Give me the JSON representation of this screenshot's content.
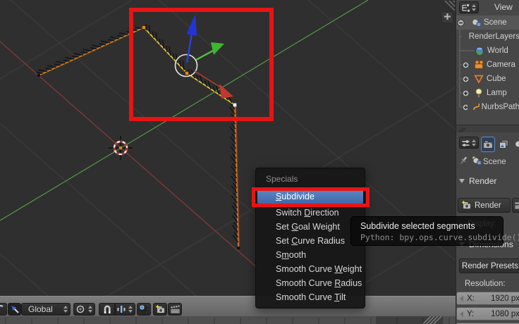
{
  "viewport": {
    "header": {
      "orientation_value": "Global"
    },
    "menu": {
      "title": "Specials",
      "items": [
        {
          "pre": "",
          "key": "S",
          "post": "ubdivide"
        },
        {
          "pre": "Switch ",
          "key": "D",
          "post": "irection"
        },
        {
          "pre": "Set ",
          "key": "G",
          "post": "oal Weight"
        },
        {
          "pre": "Set ",
          "key": "C",
          "post": "urve Radius"
        },
        {
          "pre": "S",
          "key": "m",
          "post": "ooth"
        },
        {
          "pre": "Smooth Curve ",
          "key": "W",
          "post": "eight"
        },
        {
          "pre": "Smooth Curve ",
          "key": "R",
          "post": "adius"
        },
        {
          "pre": "Smooth Curve ",
          "key": "T",
          "post": "ilt"
        }
      ]
    },
    "tooltip": {
      "title": "Subdivide selected segments",
      "python": "Python: bpy.ops.curve.subdivide()"
    }
  },
  "outliner": {
    "menu_label": "View",
    "items": [
      {
        "label": "Scene"
      },
      {
        "label": "RenderLayers"
      },
      {
        "label": "World"
      },
      {
        "label": "Camera"
      },
      {
        "label": "Cube"
      },
      {
        "label": "Lamp"
      },
      {
        "label": "NurbsPath"
      }
    ]
  },
  "properties": {
    "breadcrumb": "Scene",
    "render_panel_label": "Render",
    "render_button_label": "Render",
    "display_label": "Display:",
    "dimensions_panel_label": "Dimensions",
    "presets_button_label": "Render Presets",
    "resolution_label": "Resolution:",
    "fields": [
      {
        "label": "X:",
        "value": "1920 px"
      },
      {
        "label": "Y:",
        "value": "1080 px"
      }
    ]
  },
  "colors": {
    "annotation_red": "#e81414",
    "menu_highlight_blue": "#4f79bb",
    "axis_green": "#4f9b3f",
    "axis_red": "#8a3a3a",
    "curve_orange": "#cf7a1e",
    "curve_selected_yellow": "#dfc13f",
    "manipulator_blue": "#2e3fe0",
    "manipulator_green": "#3db82e",
    "manipulator_red": "#c03830"
  }
}
